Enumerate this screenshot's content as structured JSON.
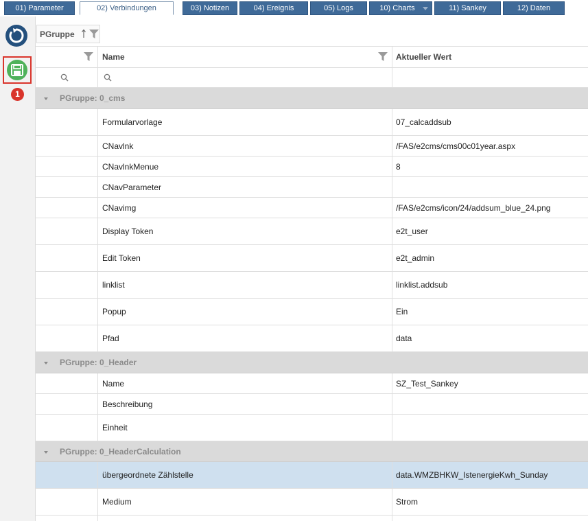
{
  "tabs": [
    {
      "label": "01) Parameter",
      "active": false
    },
    {
      "label": "02) Verbindungen",
      "active": true
    },
    {
      "label": "03) Notizen",
      "active": false
    },
    {
      "label": "04) Ereignis",
      "active": false
    },
    {
      "label": "05) Logs",
      "active": false
    },
    {
      "label": "10) Charts",
      "active": false,
      "has_dropdown": true
    },
    {
      "label": "11) Sankey",
      "active": false
    },
    {
      "label": "12) Daten",
      "active": false
    }
  ],
  "toolbar": {
    "refresh_icon": "refresh-icon",
    "save_icon": "floppy-disk-icon",
    "badge_count": "1"
  },
  "group_chip": {
    "label": "PGruppe"
  },
  "grid": {
    "columns": [
      "",
      "Name",
      "Aktueller Wert"
    ],
    "groups": [
      {
        "label": "PGruppe: 0_cms",
        "rows": [
          {
            "name": "Formularvorlage",
            "value": "07_calcaddsub"
          },
          {
            "name": "CNavlnk",
            "value": "/FAS/e2cms/cms00c01year.aspx"
          },
          {
            "name": "CNavlnkMenue",
            "value": "8"
          },
          {
            "name": "CNavParameter",
            "value": ""
          },
          {
            "name": "CNavimg",
            "value": "/FAS/e2cms/icon/24/addsum_blue_24.png"
          },
          {
            "name": "Display Token",
            "value": "e2t_user"
          },
          {
            "name": "Edit Token",
            "value": "e2t_admin"
          },
          {
            "name": "linklist",
            "value": "linklist.addsub"
          },
          {
            "name": "Popup",
            "value": "Ein"
          },
          {
            "name": "Pfad",
            "value": "data"
          }
        ]
      },
      {
        "label": "PGruppe: 0_Header",
        "rows": [
          {
            "name": "Name",
            "value": "SZ_Test_Sankey"
          },
          {
            "name": "Beschreibung",
            "value": ""
          },
          {
            "name": "Einheit",
            "value": ""
          }
        ]
      },
      {
        "label": "PGruppe: 0_HeaderCalculation",
        "rows": [
          {
            "name": "übergeordnete Zählstelle",
            "value": "data.WMZBHKW_IstenergieKwh_Sunday",
            "selected": true
          },
          {
            "name": "Medium",
            "value": "Strom"
          },
          {
            "name": "",
            "value": ""
          }
        ]
      }
    ]
  },
  "colors": {
    "tab_bg": "#3f6a98",
    "group_bg": "#dadada",
    "selected_row": "#cfe0ef",
    "save_green": "#4fb25a",
    "alert_red": "#d9342b",
    "refresh_blue": "#24507d"
  }
}
